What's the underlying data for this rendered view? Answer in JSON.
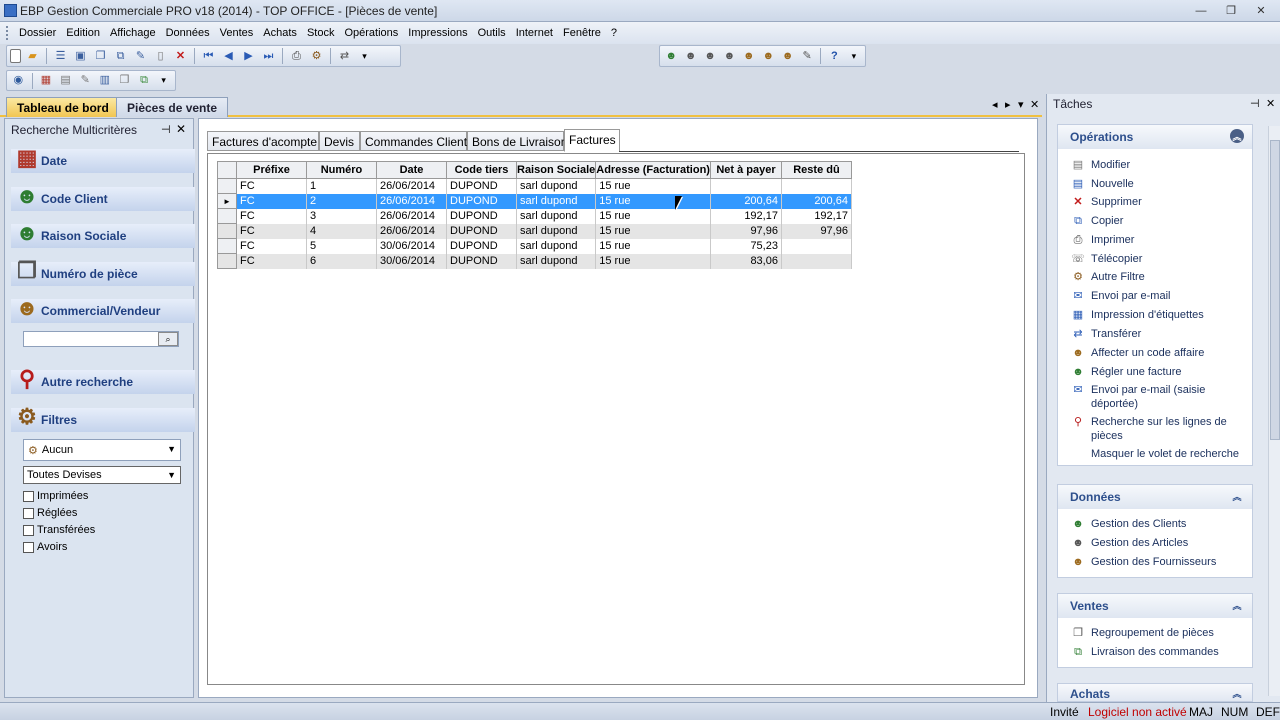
{
  "window": {
    "title": "EBP Gestion Commerciale PRO v18 (2014) - TOP OFFICE - [Pièces de vente]",
    "buttons": [
      "—",
      "❐",
      "✕"
    ]
  },
  "menu": [
    "Dossier",
    "Edition",
    "Affichage",
    "Données",
    "Ventes",
    "Achats",
    "Stock",
    "Opérations",
    "Impressions",
    "Outils",
    "Internet",
    "Fenêtre",
    "?"
  ],
  "document_tabs": {
    "items": [
      {
        "label": "Tableau de bord"
      },
      {
        "label": "Pièces de vente"
      }
    ],
    "nav": [
      "◂",
      "▸",
      "▾",
      "✕"
    ]
  },
  "left_pane": {
    "title": "Recherche Multicritères",
    "controls": [
      "⊣",
      "✕"
    ],
    "sections": [
      {
        "label": "Date",
        "icon": "calendar-icon"
      },
      {
        "label": "Code Client",
        "icon": "person-icon"
      },
      {
        "label": "Raison Sociale",
        "icon": "person-doc-icon"
      },
      {
        "label": "Numéro de pièce",
        "icon": "documents-icon"
      },
      {
        "label": "Commercial/Vendeur",
        "icon": "salesperson-icon"
      }
    ],
    "search_value": "",
    "other_search": "Autre recherche",
    "filters": {
      "label": "Filtres",
      "filter_select": "Aucun",
      "currency_select": "Toutes Devises",
      "checkboxes": [
        "Imprimées",
        "Réglées",
        "Transférées",
        "Avoirs"
      ]
    }
  },
  "content": {
    "tabs": [
      {
        "label": "Factures d'acompte",
        "active": false
      },
      {
        "label": "Devis",
        "active": false
      },
      {
        "label": "Commandes Client",
        "active": false
      },
      {
        "label": "Bons de Livraison",
        "active": false
      },
      {
        "label": "Factures",
        "active": true
      }
    ],
    "table": {
      "columns": [
        "Préfixe",
        "Numéro",
        "Date",
        "Code tiers",
        "Raison Sociale",
        "Adresse (Facturation)",
        "Net à payer",
        "Reste dû"
      ],
      "rows": [
        {
          "indicator": "",
          "cells": [
            "FC",
            "1",
            "26/06/2014",
            "DUPOND",
            "sarl dupond",
            "15 rue",
            "",
            ""
          ]
        },
        {
          "indicator": "►",
          "cells": [
            "FC",
            "2",
            "26/06/2014",
            "DUPOND",
            "sarl dupond",
            "15 rue",
            "200,64",
            "200,64"
          ]
        },
        {
          "indicator": "",
          "cells": [
            "FC",
            "3",
            "26/06/2014",
            "DUPOND",
            "sarl dupond",
            "15 rue",
            "192,17",
            "192,17"
          ]
        },
        {
          "indicator": "",
          "cells": [
            "FC",
            "4",
            "26/06/2014",
            "DUPOND",
            "sarl dupond",
            "15 rue",
            "97,96",
            "97,96"
          ]
        },
        {
          "indicator": "",
          "cells": [
            "FC",
            "5",
            "30/06/2014",
            "DUPOND",
            "sarl dupond",
            "15 rue",
            "75,23",
            ""
          ]
        },
        {
          "indicator": "",
          "cells": [
            "FC",
            "6",
            "30/06/2014",
            "DUPOND",
            "sarl dupond",
            "15 rue",
            "83,06",
            ""
          ]
        }
      ],
      "selected_row": 1
    }
  },
  "task_pane": {
    "title": "Tâches",
    "controls": [
      "⊣",
      "✕"
    ],
    "operations": {
      "title": "Opérations",
      "items": [
        {
          "label": "Modifier",
          "icon": "edit-icon"
        },
        {
          "label": "Nouvelle",
          "icon": "new-icon"
        },
        {
          "label": "Supprimer",
          "icon": "delete-icon"
        },
        {
          "label": "Copier",
          "icon": "copy-icon"
        },
        {
          "label": "Imprimer",
          "icon": "print-icon"
        },
        {
          "label": "Télécopier",
          "icon": "fax-icon"
        },
        {
          "label": "Autre Filtre",
          "icon": "filter-icon"
        },
        {
          "label": "Envoi par e-mail",
          "icon": "email-icon"
        },
        {
          "label": "Impression d'étiquettes",
          "icon": "labels-icon"
        },
        {
          "label": "Transférer",
          "icon": "transfer-icon"
        },
        {
          "label": "Affecter un code affaire",
          "icon": "affair-icon"
        },
        {
          "label": "Régler une facture",
          "icon": "payment-icon"
        },
        {
          "label": "Envoi par e-mail (saisie déportée)",
          "icon": "email-remote-icon"
        },
        {
          "label": "Recherche sur les lignes de pièces",
          "icon": "search-lines-icon"
        },
        {
          "label": "Masquer le volet de recherche",
          "icon": ""
        }
      ]
    },
    "donnees": {
      "title": "Données",
      "items": [
        {
          "label": "Gestion des Clients",
          "icon": "clients-icon"
        },
        {
          "label": "Gestion des Articles",
          "icon": "articles-icon"
        },
        {
          "label": "Gestion des Fournisseurs",
          "icon": "suppliers-icon"
        }
      ]
    },
    "ventes": {
      "title": "Ventes",
      "items": [
        {
          "label": "Regroupement de pièces",
          "icon": "group-icon"
        },
        {
          "label": "Livraison des commandes",
          "icon": "delivery-icon"
        }
      ]
    },
    "achats": {
      "title": "Achats"
    }
  },
  "status": {
    "user": "Invité",
    "warning": "Logiciel non activé",
    "maj": "MAJ",
    "num": "NUM",
    "def": "DEF"
  },
  "colors": {
    "selection": "#3399ff",
    "accent_tab": "#f0c040",
    "section_text": "#1f3f80",
    "warning": "#c00000"
  }
}
